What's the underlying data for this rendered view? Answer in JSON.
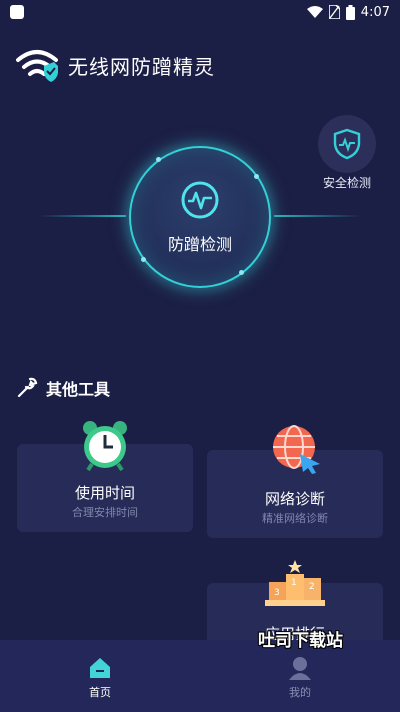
{
  "status_bar": {
    "time": "4:07"
  },
  "app": {
    "title": "无线网防蹭精灵"
  },
  "security_check": {
    "label": "安全检测"
  },
  "scan": {
    "label": "防蹭检测"
  },
  "tools_section": {
    "title": "其他工具"
  },
  "tools": [
    {
      "title": "使用时间",
      "subtitle": "合理安排时间",
      "icon": "alarm-clock-icon"
    },
    {
      "title": "网络诊断",
      "subtitle": "精准网络诊断",
      "icon": "globe-cursor-icon"
    },
    {
      "title": "应用排行",
      "subtitle": "",
      "icon": "podium-icon"
    }
  ],
  "tabbar": {
    "items": [
      {
        "label": "首页",
        "active": true,
        "icon": "home-icon"
      },
      {
        "label": "我的",
        "active": false,
        "icon": "user-icon"
      }
    ]
  },
  "watermark": "吐司下载站",
  "colors": {
    "background": "#1c1f45",
    "accent": "#33d0d8",
    "card": "#272b58",
    "tab_active": "#42d4d6",
    "tab_inactive": "#6b709a"
  }
}
